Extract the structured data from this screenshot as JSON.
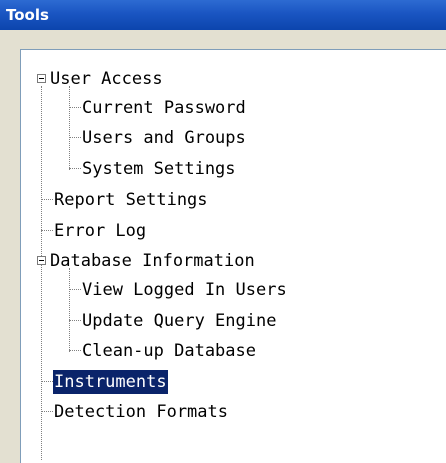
{
  "window": {
    "title": "Tools"
  },
  "tree": {
    "items": [
      {
        "label": "User Access",
        "level": 0,
        "expandable": true,
        "expanded": true,
        "selected": false
      },
      {
        "label": "Current Password",
        "level": 1,
        "expandable": false,
        "selected": false
      },
      {
        "label": "Users and Groups",
        "level": 1,
        "expandable": false,
        "selected": false
      },
      {
        "label": "System Settings",
        "level": 1,
        "expandable": false,
        "selected": false
      },
      {
        "label": "Report Settings",
        "level": 0,
        "expandable": false,
        "selected": false
      },
      {
        "label": "Error Log",
        "level": 0,
        "expandable": false,
        "selected": false
      },
      {
        "label": "Database Information",
        "level": 0,
        "expandable": true,
        "expanded": true,
        "selected": false
      },
      {
        "label": "View Logged In Users",
        "level": 1,
        "expandable": false,
        "selected": false
      },
      {
        "label": "Update Query Engine",
        "level": 1,
        "expandable": false,
        "selected": false
      },
      {
        "label": "Clean-up Database",
        "level": 1,
        "expandable": false,
        "selected": false
      },
      {
        "label": "Instruments",
        "level": 0,
        "expandable": false,
        "selected": true
      },
      {
        "label": "Detection Formats",
        "level": 0,
        "expandable": false,
        "selected": false
      }
    ]
  },
  "colors": {
    "title_bar": "#1a55c2",
    "selection": "#0a246a",
    "tree_lines": "#808080"
  },
  "icons": {
    "expander": "minus-box-icon"
  }
}
